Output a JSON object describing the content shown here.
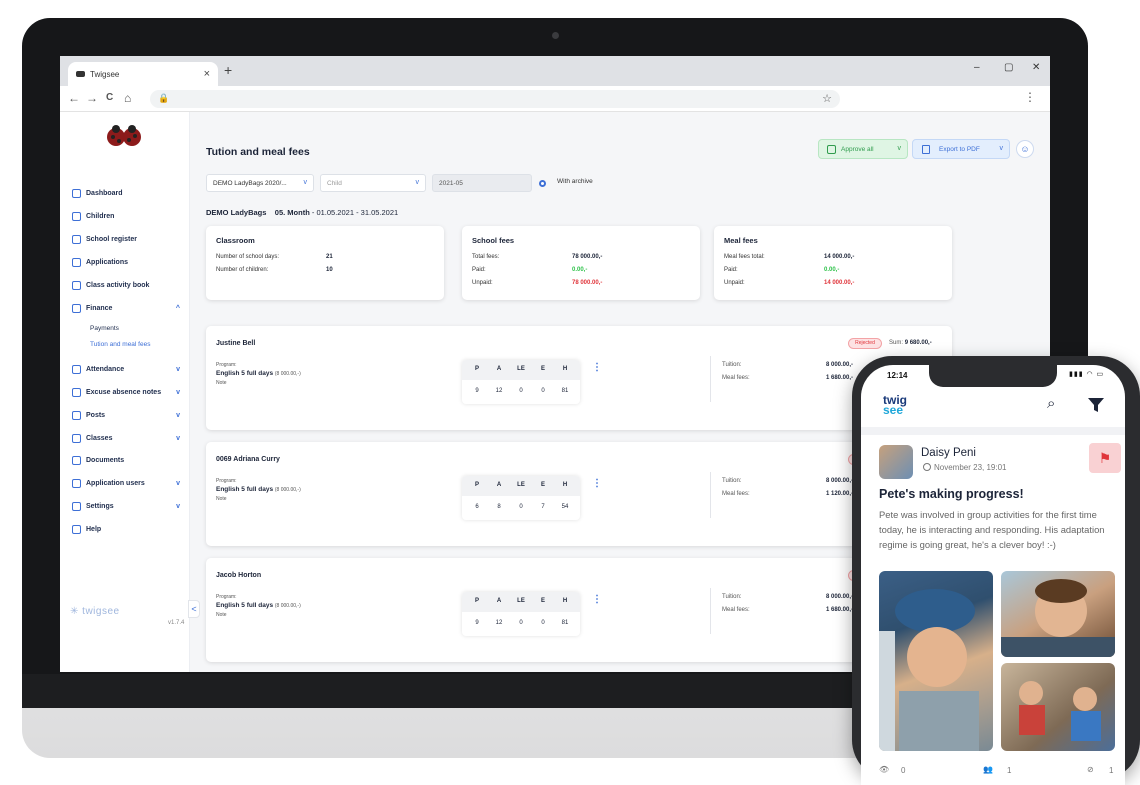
{
  "browser": {
    "tab_title": "Twigsee",
    "new_tab": "+",
    "tab_close": "×",
    "win_min": "–",
    "win_max": "▢",
    "win_close": "✕",
    "back": "←",
    "forward": "→",
    "reload": "C",
    "home": "⌂",
    "lock": "🔒",
    "star": "☆",
    "menu": "⋮"
  },
  "sidebar": {
    "items": [
      {
        "label": "Dashboard"
      },
      {
        "label": "Children"
      },
      {
        "label": "School register"
      },
      {
        "label": "Applications"
      },
      {
        "label": "Class activity book"
      },
      {
        "label": "Finance",
        "chevron": "^"
      },
      {
        "label": "Attendance",
        "chevron": "v"
      },
      {
        "label": "Excuse absence notes",
        "chevron": "v"
      },
      {
        "label": "Posts",
        "chevron": "v"
      },
      {
        "label": "Classes",
        "chevron": "v"
      },
      {
        "label": "Documents"
      },
      {
        "label": "Application users",
        "chevron": "v"
      },
      {
        "label": "Settings",
        "chevron": "v"
      },
      {
        "label": "Help"
      }
    ],
    "sub_items": [
      {
        "label": "Payments"
      },
      {
        "label": "Tution and meal fees"
      }
    ],
    "brand": "twigsee",
    "version": "v1.7.4",
    "collapse": "<"
  },
  "header": {
    "title": "Tution and meal fees",
    "approve_label": "Approve all",
    "export_label": "Export to PDF",
    "chevron": "v",
    "user_icon": "☺"
  },
  "filters": {
    "school": "DEMO LadyBags 2020/...",
    "child_placeholder": "Child",
    "month": "2021-05",
    "archive_label": "With archive"
  },
  "period": {
    "school": "DEMO LadyBags",
    "month": "05. Month",
    "range": "- 01.05.2021 - 31.05.2021"
  },
  "cards": [
    {
      "title": "Classroom",
      "rows": [
        {
          "label": "Number of school days:",
          "value": "21",
          "status": "normal"
        },
        {
          "label": "Number of children:",
          "value": "10",
          "status": "normal"
        }
      ]
    },
    {
      "title": "School fees",
      "rows": [
        {
          "label": "Total fees:",
          "value": "78 000.00,-",
          "status": "normal"
        },
        {
          "label": "Paid:",
          "value": "0.00,-",
          "status": "green"
        },
        {
          "label": "Unpaid:",
          "value": "78 000.00,-",
          "status": "red"
        }
      ]
    },
    {
      "title": "Meal fees",
      "rows": [
        {
          "label": "Meal fees total:",
          "value": "14 000.00,-",
          "status": "normal"
        },
        {
          "label": "Paid:",
          "value": "0.00,-",
          "status": "green"
        },
        {
          "label": "Unpaid:",
          "value": "14 000.00,-",
          "status": "red"
        }
      ]
    }
  ],
  "children_list": {
    "program_label": "Program:",
    "note_label": "Note",
    "headers": [
      "P",
      "A",
      "LE",
      "E",
      "H"
    ],
    "tuition_label": "Tuition:",
    "meal_label": "Meal fees:",
    "status_label": "Rejected",
    "sum_label": "Sum:",
    "kebab": "⋮",
    "rows": [
      {
        "name": "Justine Bell",
        "program": "English 5 full days",
        "program_price": "(8 000.00,-)",
        "values": [
          "9",
          "12",
          "0",
          "0",
          "81"
        ],
        "tuition": "8 000.00,-",
        "meal": "1 680.00,-",
        "sum": "9 680.00,-"
      },
      {
        "name": "0069 Adriana Curry",
        "program": "English 5 full days",
        "program_price": "(8 000.00,-)",
        "values": [
          "6",
          "8",
          "0",
          "7",
          "54"
        ],
        "tuition": "8 000.00,-",
        "meal": "1 120.00,-"
      },
      {
        "name": "Jacob Horton",
        "program": "English 5 full days",
        "program_price": "(8 000.00,-)",
        "values": [
          "9",
          "12",
          "0",
          "0",
          "81"
        ],
        "tuition": "8 000.00,-",
        "meal": "1 680.00,-"
      }
    ]
  },
  "phone": {
    "time": "12:14",
    "status": "▮▮▮ ◠ ▭",
    "logo_top": "twig",
    "logo_bottom": "see",
    "search_icon": "⌕",
    "author": "Daisy Peni",
    "date": "November 23, 19:01",
    "flag": "⚑",
    "post_title": "Pete's making progress!",
    "post_body": "Pete was involved in group activities for the first time today, he is interacting and responding. His adaptation regime is going great, he's a clever boy! :-)",
    "views": "0",
    "users": "1",
    "hidden": "1"
  },
  "colors": {
    "accent": "#3d6fd6",
    "green": "#2ec24a",
    "red": "#e0353b",
    "phone_brand": "#1a3a7a"
  }
}
